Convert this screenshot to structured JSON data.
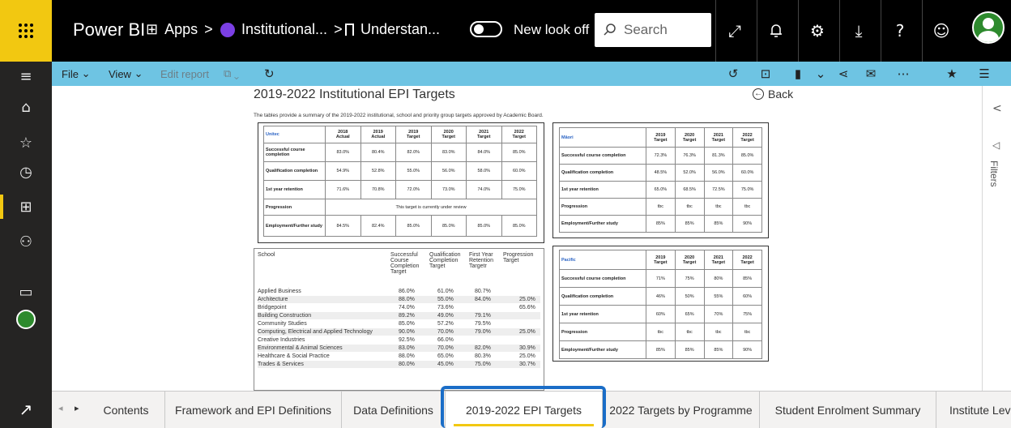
{
  "topbar": {
    "brand": "Power BI",
    "crumbs": [
      "Apps",
      "Institutional...",
      "Understan..."
    ],
    "new_look": "New look off",
    "search_placeholder": "Search"
  },
  "toolbar": {
    "file": "File",
    "view": "View",
    "edit_report": "Edit report"
  },
  "report": {
    "title": "2019-2022 Institutional EPI Targets",
    "back": "Back",
    "summary": "The tables provide a summary of the 2019-2022 institutional, school and priority group targets approved by Academic Board."
  },
  "filters_label": "Filters",
  "unitec": {
    "entity": "Unitec",
    "years": [
      "2018",
      "2019",
      "2019",
      "2020",
      "2021",
      "2022"
    ],
    "kinds": [
      "Actual",
      "Actual",
      "Target",
      "Target",
      "Target",
      "Target"
    ],
    "rows": [
      {
        "label": "Successful course completion",
        "values": [
          "83.0%",
          "80.4%",
          "82.0%",
          "83.0%",
          "84.0%",
          "85.0%"
        ]
      },
      {
        "label": "Qualification completion",
        "values": [
          "54.9%",
          "52.8%",
          "55.0%",
          "56.0%",
          "58.0%",
          "60.0%"
        ]
      },
      {
        "label": "1st year retention",
        "values": [
          "71.6%",
          "70.8%",
          "72.0%",
          "73.0%",
          "74.0%",
          "75.0%"
        ]
      },
      {
        "label": "Progression",
        "note": "This target is currently under review"
      },
      {
        "label": "Employment/Further study",
        "values": [
          "84.5%",
          "82.4%",
          "85.0%",
          "85.0%",
          "85.0%",
          "85.0%"
        ]
      }
    ]
  },
  "maori": {
    "entity": "Māori",
    "years": [
      "2019",
      "2020",
      "2021",
      "2022"
    ],
    "kind": "Target",
    "rows": [
      {
        "label": "Successful course completion",
        "values": [
          "72.3%",
          "76.3%",
          "81.3%",
          "85.0%"
        ]
      },
      {
        "label": "Qualification completion",
        "values": [
          "48.5%",
          "52.0%",
          "56.0%",
          "60.0%"
        ]
      },
      {
        "label": "1st year retention",
        "values": [
          "65.0%",
          "68.5%",
          "72.5%",
          "75.0%"
        ]
      },
      {
        "label": "Progression",
        "values": [
          "tbc",
          "tbc",
          "tbc",
          "tbc"
        ]
      },
      {
        "label": "Employment/Further study",
        "values": [
          "85%",
          "85%",
          "85%",
          "90%"
        ]
      }
    ]
  },
  "pacific": {
    "entity": "Pacific",
    "years": [
      "2019",
      "2020",
      "2021",
      "2022"
    ],
    "kind": "Target",
    "rows": [
      {
        "label": "Successful course completion",
        "values": [
          "71%",
          "75%",
          "80%",
          "85%"
        ]
      },
      {
        "label": "Qualification completion",
        "values": [
          "46%",
          "50%",
          "55%",
          "60%"
        ]
      },
      {
        "label": "1st year retention",
        "values": [
          "60%",
          "65%",
          "70%",
          "75%"
        ]
      },
      {
        "label": "Progression",
        "values": [
          "tbc",
          "tbc",
          "tbc",
          "tbc"
        ]
      },
      {
        "label": "Employment/Further study",
        "values": [
          "85%",
          "85%",
          "85%",
          "90%"
        ]
      }
    ]
  },
  "school": {
    "headers": [
      "School",
      "Successful Course Completion Target",
      "Qualification Completion Target",
      "First Year Retention Targetr",
      "Progression Target"
    ],
    "rows": [
      [
        "Applied Business",
        "86.0%",
        "61.0%",
        "80.7%",
        ""
      ],
      [
        "Architecture",
        "88.0%",
        "55.0%",
        "84.0%",
        "25.0%"
      ],
      [
        "Bridgepoint",
        "74.0%",
        "73.6%",
        "",
        "65.6%"
      ],
      [
        "Building Construction",
        "89.2%",
        "49.0%",
        "79.1%",
        ""
      ],
      [
        "Community Studies",
        "85.0%",
        "57.2%",
        "79.5%",
        ""
      ],
      [
        "Computing, Electrical and Applied Technology",
        "90.0%",
        "70.0%",
        "79.0%",
        "25.0%"
      ],
      [
        "Creative Industries",
        "92.5%",
        "66.0%",
        "",
        ""
      ],
      [
        "Environmental & Animal Sciences",
        "83.0%",
        "70.0%",
        "82.0%",
        "30.9%"
      ],
      [
        "Healthcare & Social Practice",
        "88.0%",
        "65.0%",
        "80.3%",
        "25.0%"
      ],
      [
        "Trades & Services",
        "80.0%",
        "45.0%",
        "75.0%",
        "30.7%"
      ]
    ]
  },
  "tabs": [
    "Contents",
    "Framework and EPI Definitions",
    "Data Definitions",
    "2019-2022 EPI Targets",
    "2022 Targets by Programme",
    "Student Enrolment Summary",
    "Institute Leve"
  ],
  "active_tab": "2019-2022 EPI Targets",
  "colors": {
    "accent": "#f2c811",
    "toolbar": "#6ec4e3",
    "highlight": "#1a6dc7",
    "rail": "#252423"
  }
}
